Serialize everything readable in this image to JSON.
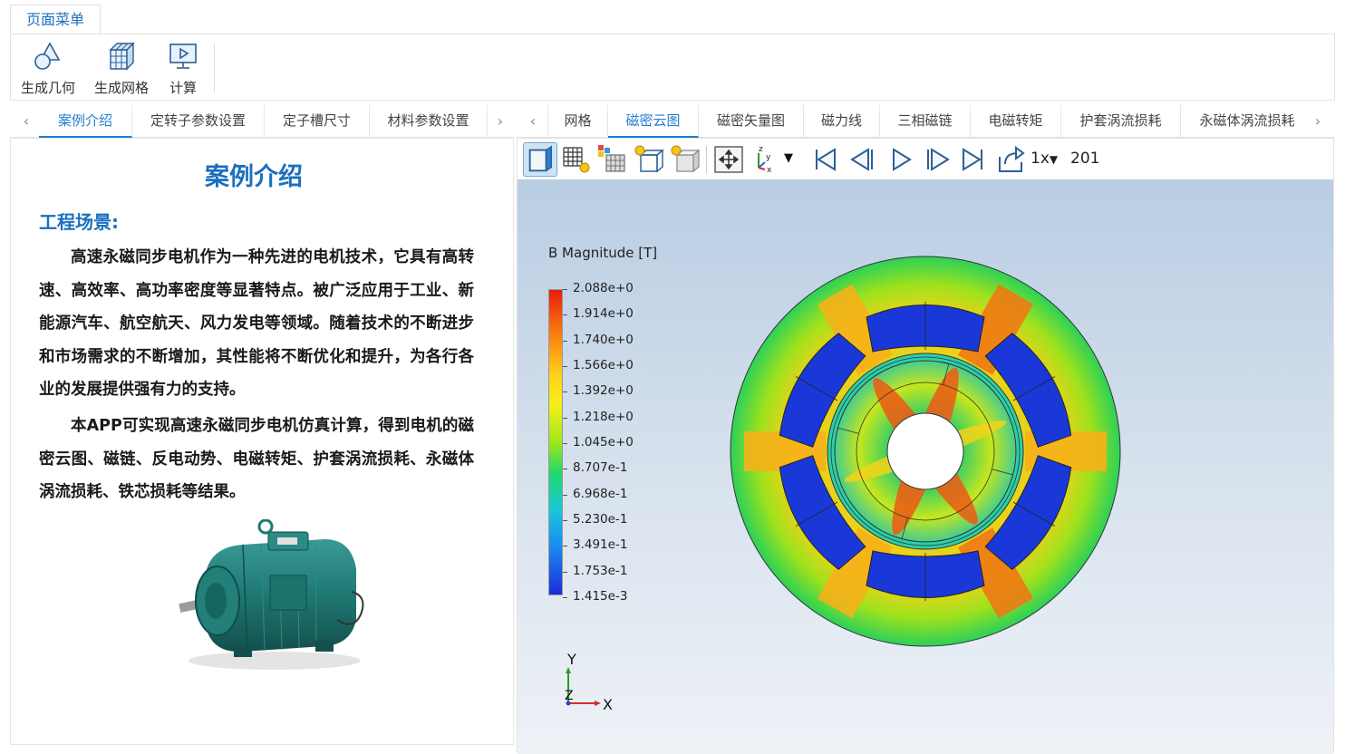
{
  "menu": {
    "tab_label": "页面菜单"
  },
  "ribbon": {
    "buttons": [
      {
        "label": "生成几何",
        "icon": "geometry-icon"
      },
      {
        "label": "生成网格",
        "icon": "mesh-icon"
      },
      {
        "label": "计算",
        "icon": "compute-icon"
      }
    ]
  },
  "left_tabs": {
    "items": [
      "案例介绍",
      "定转子参数设置",
      "定子槽尺寸",
      "材料参数设置"
    ],
    "active": "案例介绍"
  },
  "right_tabs": {
    "items": [
      "网格",
      "磁密云图",
      "磁密矢量图",
      "磁力线",
      "三相磁链",
      "电磁转矩",
      "护套涡流损耗",
      "永磁体涡流损耗"
    ],
    "active": "磁密云图"
  },
  "intro": {
    "title": "案例介绍",
    "section": "工程场景:",
    "paragraph1": "高速永磁同步电机作为一种先进的电机技术，它具有高转速、高效率、高功率密度等显著特点。被广泛应用于工业、新能源汽车、航空航天、风力发电等领域。随着技术的不断进步和市场需求的不断增加，其性能将不断优化和提升，为各行各业的发展提供强有力的支持。",
    "paragraph2": "本APP可实现高速永磁同步电机仿真计算，得到电机的磁密云图、磁链、反电动势、电磁转矩、护套涡流损耗、永磁体涡流损耗、铁芯损耗等结果。"
  },
  "viewer": {
    "speed": "1x",
    "frame": "201",
    "legend_title": "B Magnitude [T]",
    "legend_ticks": [
      "2.088e+0",
      "1.914e+0",
      "1.740e+0",
      "1.566e+0",
      "1.392e+0",
      "1.218e+0",
      "1.045e+0",
      "8.707e-1",
      "6.968e-1",
      "5.230e-1",
      "3.491e-1",
      "1.753e-1",
      "1.415e-3"
    ],
    "axis_y": "Y",
    "axis_x": "X",
    "axis_z": "Z"
  },
  "colors": {
    "accent": "#1f7fcf",
    "title_blue": "#1b6fbf"
  }
}
